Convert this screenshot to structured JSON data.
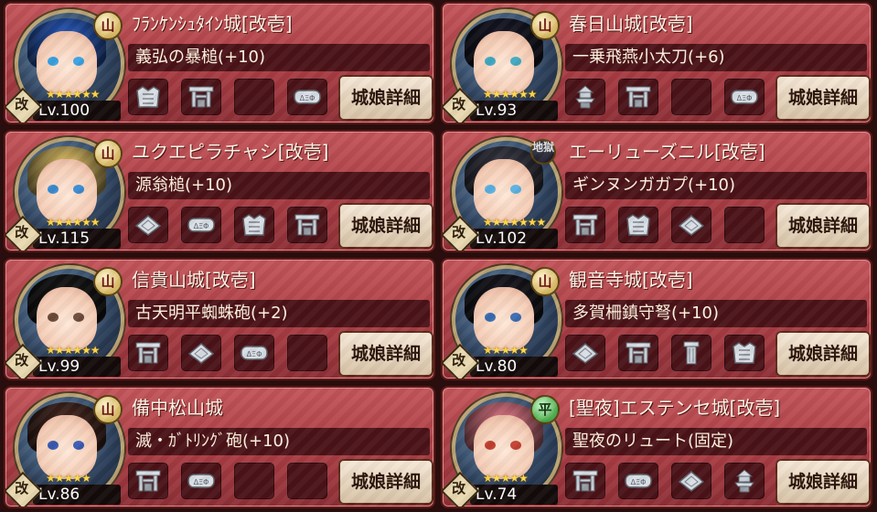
{
  "detail_label": "城娘詳細",
  "cards": [
    {
      "name": "ﾌﾗﾝｹﾝｼｭﾀｲﾝ城[改壱]",
      "weapon": "義弘の暴槌(+10)",
      "level": "Lv.100",
      "badge": "山",
      "badge_type": "yama",
      "stars": "★★★★★★",
      "slots": [
        "armor",
        "gate",
        "empty",
        "ring"
      ],
      "hair": "#2a5fc8",
      "eyes": "#3aa0e0"
    },
    {
      "name": "春日山城[改壱]",
      "weapon": "一乗飛燕小太刀(+6)",
      "level": "Lv.93",
      "badge": "山",
      "badge_type": "yama",
      "stars": "★★★★★★",
      "slots": [
        "tower",
        "gate",
        "empty",
        "ring"
      ],
      "hair": "#1a1a2a",
      "eyes": "#40a8c0"
    },
    {
      "name": "ユクエピラチャシ[改壱]",
      "weapon": "源翁槌(+10)",
      "level": "Lv.115",
      "badge": "山",
      "badge_type": "yama",
      "stars": "★★★★★★",
      "slots": [
        "wall",
        "ring",
        "armor",
        "gate"
      ],
      "hair": "#e8c86a",
      "eyes": "#3a8ad0"
    },
    {
      "name": "エーリューズニル[改壱]",
      "weapon": "ギンヌンガガプ(+10)",
      "level": "Lv.102",
      "badge": "地獄",
      "badge_type": "jigoku",
      "stars": "★★★★★★★",
      "slots": [
        "gate",
        "armor",
        "wall",
        "empty"
      ],
      "hair": "#3a3a48",
      "eyes": "#5ab0e0"
    },
    {
      "name": "信貴山城[改壱]",
      "weapon": "古天明平蜘蛛砲(+2)",
      "level": "Lv.99",
      "badge": "山",
      "badge_type": "yama",
      "stars": "★★★★★★",
      "slots": [
        "gate",
        "wall",
        "ring",
        "empty"
      ],
      "hair": "#181818",
      "eyes": "#6a4a3a"
    },
    {
      "name": "観音寺城[改壱]",
      "weapon": "多賀柵鎮守弩(+10)",
      "level": "Lv.80",
      "badge": "山",
      "badge_type": "yama",
      "stars": "★★★★★",
      "slots": [
        "wall",
        "gate",
        "pillar",
        "armor"
      ],
      "hair": "#1a1a22",
      "eyes": "#3a6ab0"
    },
    {
      "name": "備中松山城",
      "weapon": "滅・ｶﾞﾄﾘﾝｸﾞ砲(+10)",
      "level": "Lv.86",
      "badge": "山",
      "badge_type": "yama",
      "stars": "★★★★★",
      "slots": [
        "gate",
        "ring",
        "empty",
        "empty"
      ],
      "hair": "#4a2a22",
      "eyes": "#3a5ab0"
    },
    {
      "name": "[聖夜]エステンセ城[改壱]",
      "weapon": "聖夜のリュート(固定)",
      "level": "Lv.74",
      "badge": "平",
      "badge_type": "hei",
      "stars": "★★★★★",
      "slots": [
        "gate",
        "ring",
        "wall",
        "tower"
      ],
      "hair": "#e87a8a",
      "eyes": "#c04030"
    }
  ],
  "kai_label": "改"
}
